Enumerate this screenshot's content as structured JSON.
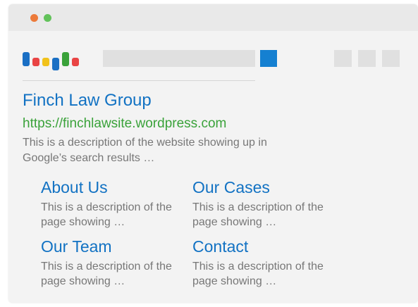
{
  "window": {
    "traffic_lights": [
      {
        "name": "close",
        "color": "#ec7a3a"
      },
      {
        "name": "maximize",
        "color": "#62c25a"
      }
    ]
  },
  "logo": {
    "icon": "search-engine-logo-icon",
    "bar_colors": [
      "#1a6fc4",
      "#e94444",
      "#f1c21b",
      "#1a6fc4",
      "#3aa23a",
      "#e94444"
    ]
  },
  "search": {
    "placeholder": "",
    "button_icon": "search-button-icon",
    "button_color": "#1580d1"
  },
  "toolbar": {
    "square_count_icons": [
      "toolbar-square-icon",
      "toolbar-square-icon",
      "toolbar-square-icon"
    ]
  },
  "result": {
    "title": "Finch Law Group",
    "url": "https://finchlawsite.wordpress.com",
    "description": "This is a description of the website showing up in Google’s search results …"
  },
  "sitelinks": [
    {
      "title": "About Us",
      "description": "This is a description of the page showing …"
    },
    {
      "title": "Our Cases",
      "description": "This is a description of the page showing …"
    },
    {
      "title": "Our Team",
      "description": "This is a description of the page showing …"
    },
    {
      "title": "Contact",
      "description": "This is a description of the page showing …"
    }
  ],
  "colors": {
    "link": "#1272c3",
    "url": "#3aa23a",
    "text": "#777777",
    "window_bg": "#f3f3f3",
    "titlebar_bg": "#e9e9e9"
  }
}
